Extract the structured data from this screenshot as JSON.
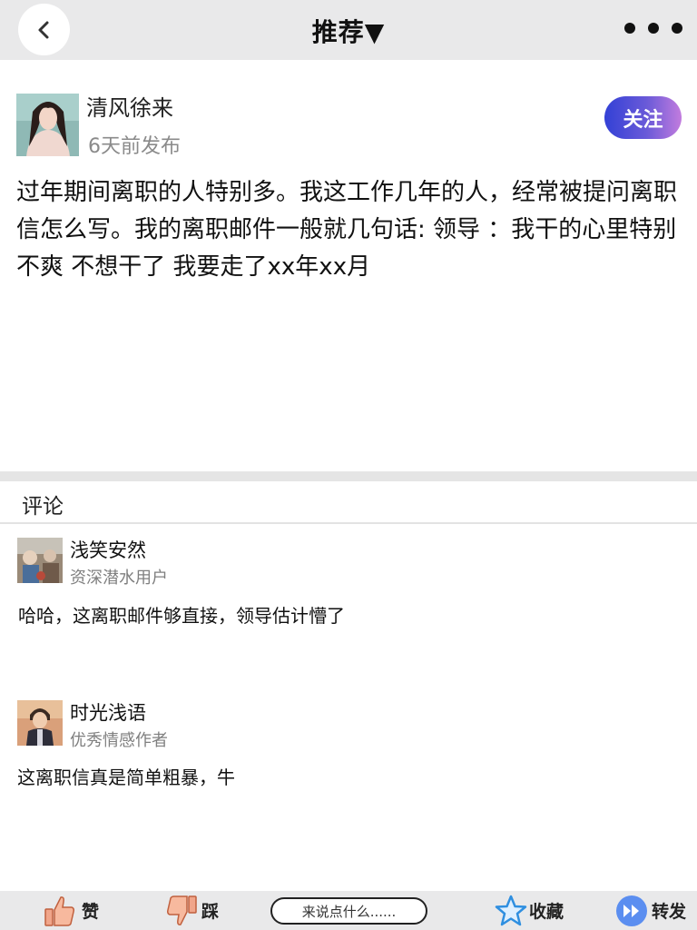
{
  "header": {
    "title": "推荐▼",
    "back_icon": "chevron-left-icon",
    "more_icon": "more-dots-icon"
  },
  "post": {
    "author": "清风徐来",
    "time": "6天前发布",
    "follow_label": "关注",
    "content": "过年期间离职的人特别多。我这工作几年的人，经常被提问离职信怎么写。我的离职邮件一般就几句话: 领导 ：我干的心里特别不爽  不想干了  我要走了xx年xx月"
  },
  "comments": {
    "title": "评论",
    "items": [
      {
        "name": "浅笑安然",
        "role": "资深潜水用户",
        "text": "哈哈，这离职邮件够直接，领导估计懵了"
      },
      {
        "name": "时光浅语",
        "role": "优秀情感作者",
        "text": "这离职信真是简单粗暴，牛"
      }
    ]
  },
  "bottom_bar": {
    "like_label": "赞",
    "dislike_label": "踩",
    "input_placeholder": "来说点什么......",
    "favorite_label": "收藏",
    "share_label": "转发"
  },
  "colors": {
    "follow_gradient_start": "#3341d6",
    "follow_gradient_end": "#c27cde",
    "bar_background": "#e9e9ea",
    "star_color": "#2f8fe0",
    "share_color": "#5b8ef0",
    "thumb_color": "#f0a58a"
  }
}
